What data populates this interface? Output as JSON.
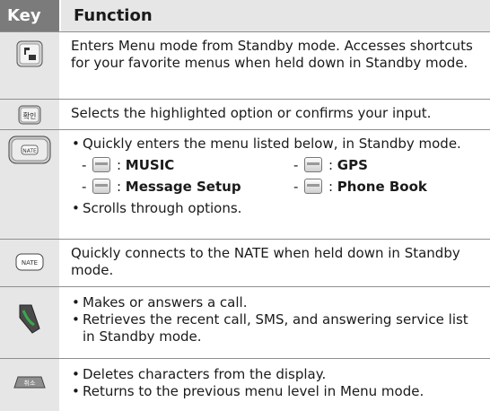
{
  "header": {
    "key": "Key",
    "function": "Function"
  },
  "rows": [
    {
      "icon": "menu-key-icon",
      "text": "Enters Menu mode from Standby mode. Accesses shortcuts for your favorite menus when held down in Standby mode."
    },
    {
      "icon": "confirm-key-icon",
      "key_label": "확인",
      "text": "Selects the highlighted option or confirms your input."
    },
    {
      "icon": "navigation-key-icon",
      "intro": "Quickly enters the menu listed below, in Standby mode.",
      "shortcuts": [
        {
          "icon": "music-key-icon",
          "label": "MUSIC"
        },
        {
          "icon": "gps-key-icon",
          "label": "GPS"
        },
        {
          "icon": "message-key-icon",
          "label": "Message Setup"
        },
        {
          "icon": "phonebook-key-icon",
          "label": "Phone Book"
        }
      ],
      "outro": "Scrolls through options."
    },
    {
      "icon": "nate-key-icon",
      "key_label": "NATE",
      "text": "Quickly connects to the NATE when held down in Standby mode."
    },
    {
      "icon": "call-key-icon",
      "bullets": [
        "Makes or answers a call.",
        "Retrieves the recent call, SMS, and answering service list in Standby mode."
      ]
    },
    {
      "icon": "cancel-key-icon",
      "key_label": "취소",
      "bullets": [
        "Deletes characters from the display.",
        "Returns to the previous menu level in Menu mode."
      ]
    }
  ],
  "separators": {
    "dash": "- ",
    "colon": " : "
  }
}
